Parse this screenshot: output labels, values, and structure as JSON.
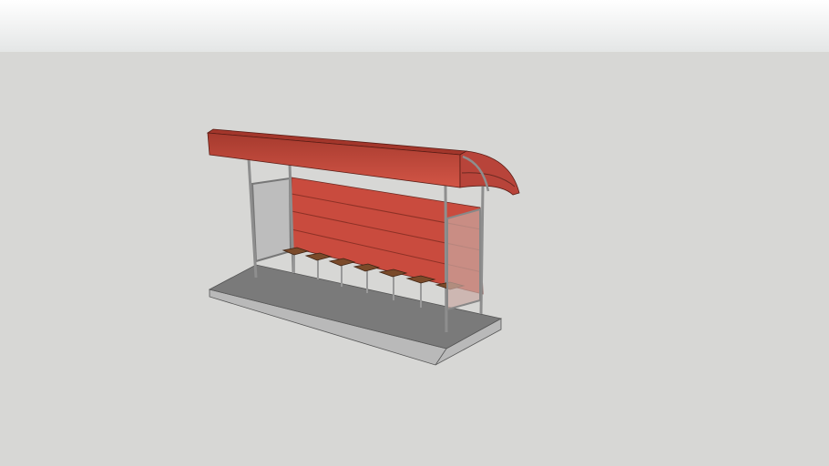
{
  "scene": {
    "subject": "bus-shelter-3d-model",
    "colors": {
      "sky_top": "#ffffff",
      "sky_bottom": "#e4e6e6",
      "ground": "#d7d7d5",
      "roof": "#c8473a",
      "roof_dark": "#a3362b",
      "back_panel": "#c94b3e",
      "frame": "#8e8e8e",
      "glass": "#bdbdbd",
      "seat": "#7a4a2a",
      "platform_top": "#7a7a7a",
      "platform_side": "#b9b9b9"
    },
    "seat_count": 7
  }
}
